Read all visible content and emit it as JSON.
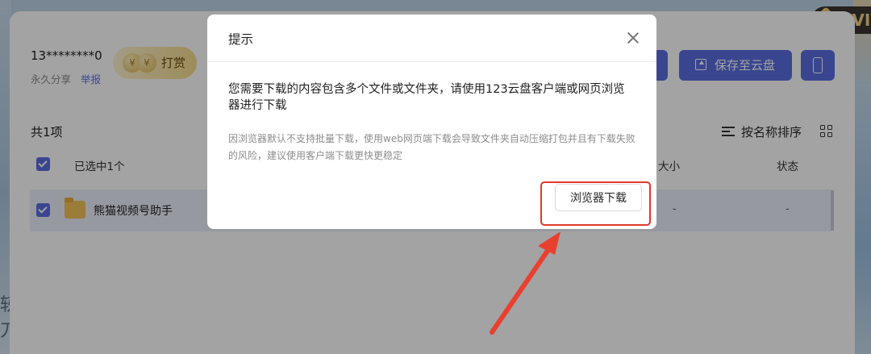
{
  "share": {
    "user_id": "13********0",
    "share_type": "永久分享",
    "report_label": "举报",
    "tip_label": "打赏",
    "coin_glyph": "¥"
  },
  "header_actions": {
    "save_label": "保存至云盘",
    "badge_text": "SVI"
  },
  "list": {
    "total_count": "共1项",
    "sort_label": "按名称排序",
    "selected_label": "已选中1个",
    "columns": {
      "size": "大小",
      "status": "状态"
    },
    "rows": [
      {
        "name": "熊猫视频号助手",
        "size": "-",
        "status": "-"
      }
    ]
  },
  "background_text": {
    "glyph_1": "轫",
    "glyph_2": "刀"
  },
  "dialog": {
    "title": "提示",
    "message": "您需要下载的内容包含多个文件或文件夹，请使用123云盘客户端或网页浏览器进行下载",
    "note": "因浏览器默认不支持批量下载，使用web网页端下载会导致文件夹自动压缩打包并且有下载失败的风险，建议使用客户端下载更快更稳定",
    "browser_download_label": "浏览器下载"
  },
  "colors": {
    "accent": "#5a6ee0",
    "annotation": "#e1382c",
    "overlay": "rgba(0,0,0,0.36)"
  }
}
